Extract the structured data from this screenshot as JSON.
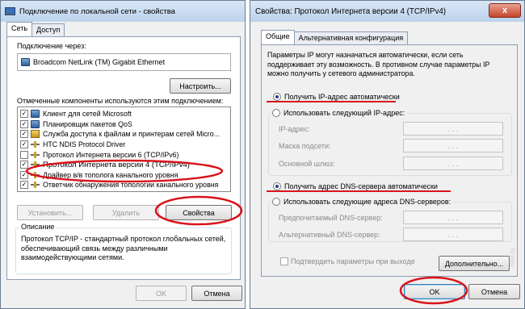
{
  "left_window": {
    "title": "Подключение по локальной сети - свойства",
    "tabs": [
      {
        "label": "Сеть"
      },
      {
        "label": "Доступ"
      }
    ],
    "connect_through_label": "Подключение через:",
    "adapter_name": "Broadcom NetLink (TM) Gigabit Ethernet",
    "configure_button": "Настроить...",
    "components_label": "Отмеченные компоненты используются этим подключением:",
    "components": [
      {
        "label": "Клиент для сетей Microsoft",
        "checked": true,
        "icon": "network-client-icon"
      },
      {
        "label": "Планировщик пакетов QoS",
        "checked": true,
        "icon": "network-client-icon"
      },
      {
        "label": "Служба доступа к файлам и принтерам сетей Micro...",
        "checked": true,
        "icon": "file-sharing-icon"
      },
      {
        "label": "HTC NDIS Protocol Driver",
        "checked": true,
        "icon": "protocol-icon"
      },
      {
        "label": "Протокол Интернета версии 6 (TCP/IPv6)",
        "checked": false,
        "icon": "protocol-icon"
      },
      {
        "label": "Протокол Интернета версии 4 (TCP/IPv4)",
        "checked": true,
        "icon": "protocol-icon"
      },
      {
        "label": "Драйвер в/в тополога канального уровня",
        "checked": true,
        "icon": "protocol-icon"
      },
      {
        "label": "Ответчик обнаружения топологии канального уровня",
        "checked": true,
        "icon": "protocol-icon"
      }
    ],
    "install_button": "Установить...",
    "remove_button": "Удалить",
    "properties_button": "Свойства",
    "description_title": "Описание",
    "description_text": "Протокол TCP/IP - стандартный протокол глобальных сетей, обеспечивающий связь между различными взаимодействующими сетями.",
    "ok_button": "OK",
    "cancel_button": "Отмена"
  },
  "right_window": {
    "title": "Свойства: Протокол Интернета версии 4 (TCP/IPv4)",
    "close_glyph": "x",
    "tabs": [
      {
        "label": "Общие"
      },
      {
        "label": "Альтернативная конфигурация"
      }
    ],
    "intro_text": "Параметры IP могут назначаться автоматически, если сеть поддерживает эту возможность. В противном случае параметры IP можно получить у сетевого администратора.",
    "ip_auto_label": "Получить IP-адрес автоматически",
    "ip_manual_label": "Использовать следующий IP-адрес:",
    "ip_address_label": "IP-адрес:",
    "subnet_label": "Маска подсети:",
    "gateway_label": "Основной шлюз:",
    "ip_dots": ".   .   .",
    "dns_auto_label": "Получить адрес DNS-сервера автоматически",
    "dns_manual_label": "Использовать следующие адреса DNS-серверов:",
    "preferred_dns_label": "Предпочитаемый DNS-сервер:",
    "alternate_dns_label": "Альтернативный DNS-сервер:",
    "validate_label": "Подтвердить параметры при выходе",
    "advanced_button": "Дополнительно...",
    "ok_button": "OK",
    "cancel_button": "Отмена",
    "ip_mode": "auto",
    "dns_mode": "auto",
    "validate_checked": false
  },
  "watermark": "hnd.ru",
  "annotation_color": "#d9141b"
}
